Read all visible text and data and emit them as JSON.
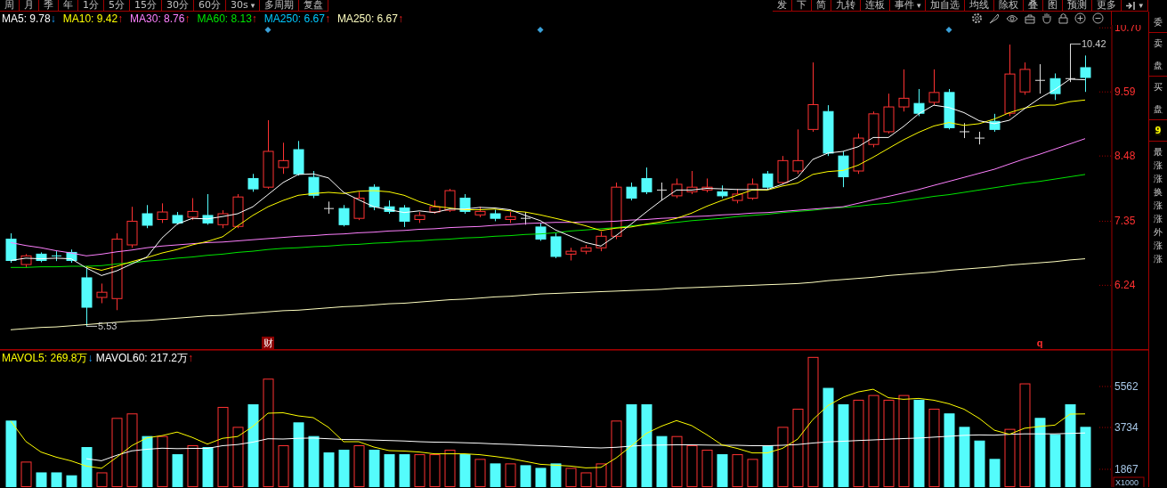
{
  "toolbar": {
    "left": [
      {
        "label": "周"
      },
      {
        "label": "月"
      },
      {
        "label": "季"
      },
      {
        "label": "年"
      },
      {
        "label": "1分"
      },
      {
        "label": "5分"
      },
      {
        "label": "15分"
      },
      {
        "label": "30分"
      },
      {
        "label": "60分"
      },
      {
        "label": "30s",
        "caret": "▾"
      },
      {
        "label": "多周期"
      },
      {
        "label": "复盘"
      }
    ],
    "right": [
      {
        "kind": "text",
        "label": "发"
      },
      {
        "kind": "text",
        "label": "下"
      },
      {
        "kind": "text",
        "label": "简"
      },
      {
        "kind": "text",
        "label": "九转"
      },
      {
        "kind": "text",
        "label": "连板"
      },
      {
        "kind": "text",
        "label": "事件",
        "caret": "▾"
      },
      {
        "kind": "text",
        "label": "加自选"
      },
      {
        "kind": "text",
        "label": "均线"
      },
      {
        "kind": "text",
        "label": "除权"
      },
      {
        "kind": "text",
        "label": "叠"
      },
      {
        "kind": "text",
        "label": "图"
      },
      {
        "kind": "text",
        "label": "预测"
      },
      {
        "kind": "text",
        "label": "更多"
      },
      {
        "kind": "icon",
        "caret": "▾"
      }
    ]
  },
  "ma_legend": [
    {
      "label": "MA5: 9.78",
      "arrow": "↓",
      "kind": "down",
      "color": "#ffffff"
    },
    {
      "label": "MA10: 9.42",
      "arrow": "↑",
      "kind": "up",
      "color": "#ffff00"
    },
    {
      "label": "MA30: 8.76",
      "arrow": "↑",
      "kind": "up",
      "color": "#ff80ff"
    },
    {
      "label": "MA60: 8.13",
      "arrow": "↑",
      "kind": "up",
      "color": "#00e600"
    },
    {
      "label": "MA250: 6.67",
      "arrow": "↑",
      "kind": "up",
      "color": "#00c8ff"
    },
    {
      "label": "MA250: 6.67",
      "arrow": "↑",
      "kind": "up",
      "color": "#ffffc0"
    }
  ],
  "price_panel": {
    "chart_data": {
      "type": "candlestick",
      "categories": [
        null,
        null,
        null,
        null,
        null,
        null,
        null,
        null,
        null,
        null,
        null,
        null,
        null,
        null,
        null,
        null,
        null,
        null,
        null,
        null,
        null,
        null,
        null,
        null,
        null,
        null,
        null,
        null,
        null,
        null,
        null,
        null,
        null,
        null,
        null,
        null,
        null,
        null,
        null,
        null,
        null,
        null,
        null,
        null,
        null,
        null,
        null,
        null,
        null,
        null,
        null,
        null,
        null,
        null,
        null,
        null,
        null,
        null,
        null,
        null,
        null,
        null,
        null,
        null,
        null,
        null,
        null,
        null,
        null,
        null,
        null,
        null
      ],
      "ylim": [
        5.12,
        10.75
      ],
      "yticks": [
        {
          "value": 10.7,
          "label": "10.70"
        },
        9.59,
        8.48,
        7.35,
        6.24
      ],
      "ohlc": [
        [
          7.04,
          7.14,
          6.63,
          6.67
        ],
        [
          6.6,
          6.78,
          6.55,
          6.75
        ],
        [
          6.78,
          6.81,
          6.64,
          6.67
        ],
        [
          6.75,
          6.83,
          6.66,
          6.74
        ],
        [
          6.81,
          6.86,
          6.63,
          6.67
        ],
        [
          6.37,
          6.55,
          5.53,
          5.86
        ],
        [
          6.03,
          6.27,
          5.93,
          6.12
        ],
        [
          6.01,
          7.14,
          5.81,
          7.04
        ],
        [
          6.94,
          7.6,
          6.89,
          7.35
        ],
        [
          7.48,
          7.63,
          7.23,
          7.28
        ],
        [
          7.38,
          7.66,
          7.32,
          7.51
        ],
        [
          7.45,
          7.51,
          7.29,
          7.32
        ],
        [
          7.42,
          7.75,
          7.37,
          7.52
        ],
        [
          7.45,
          7.82,
          7.29,
          7.32
        ],
        [
          7.29,
          7.54,
          7.23,
          7.48
        ],
        [
          7.26,
          7.82,
          7.23,
          7.77
        ],
        [
          8.09,
          8.17,
          7.86,
          7.91
        ],
        [
          7.94,
          9.1,
          7.91,
          8.56
        ],
        [
          8.28,
          8.71,
          8.17,
          8.4
        ],
        [
          8.59,
          8.74,
          8.14,
          8.17
        ],
        [
          8.11,
          8.22,
          7.75,
          7.8
        ],
        [
          7.57,
          7.69,
          7.48,
          7.57
        ],
        [
          7.57,
          7.63,
          7.26,
          7.29
        ],
        [
          7.4,
          7.86,
          7.37,
          7.75
        ],
        [
          7.94,
          7.99,
          7.54,
          7.6
        ],
        [
          7.6,
          7.71,
          7.48,
          7.52
        ],
        [
          7.58,
          7.63,
          7.25,
          7.35
        ],
        [
          7.38,
          7.51,
          7.32,
          7.45
        ],
        [
          7.51,
          7.71,
          7.48,
          7.6
        ],
        [
          7.54,
          7.91,
          7.51,
          7.88
        ],
        [
          7.75,
          7.82,
          7.48,
          7.52
        ],
        [
          7.46,
          7.6,
          7.42,
          7.52
        ],
        [
          7.48,
          7.55,
          7.35,
          7.4
        ],
        [
          7.38,
          7.51,
          7.32,
          7.43
        ],
        [
          7.4,
          7.51,
          7.29,
          7.4
        ],
        [
          7.25,
          7.32,
          7.01,
          7.04
        ],
        [
          7.08,
          7.14,
          6.71,
          6.74
        ],
        [
          6.78,
          6.89,
          6.67,
          6.83
        ],
        [
          6.83,
          6.94,
          6.78,
          6.89
        ],
        [
          6.89,
          7.17,
          6.83,
          7.09
        ],
        [
          7.09,
          8.02,
          7.04,
          7.94
        ],
        [
          7.94,
          8.02,
          7.71,
          7.75
        ],
        [
          8.09,
          8.28,
          7.82,
          7.86
        ],
        [
          7.89,
          8.02,
          7.71,
          7.89
        ],
        [
          7.79,
          8.09,
          7.75,
          7.99
        ],
        [
          7.86,
          8.22,
          7.82,
          7.94
        ],
        [
          7.89,
          8.09,
          7.85,
          7.94
        ],
        [
          7.86,
          7.97,
          7.75,
          7.79
        ],
        [
          7.71,
          7.91,
          7.66,
          7.82
        ],
        [
          7.75,
          8.09,
          7.72,
          7.99
        ],
        [
          8.17,
          8.22,
          7.91,
          7.94
        ],
        [
          8.02,
          8.48,
          7.99,
          8.4
        ],
        [
          8.22,
          8.94,
          8.17,
          8.4
        ],
        [
          8.94,
          10.1,
          8.9,
          9.37
        ],
        [
          9.25,
          9.36,
          8.48,
          8.53
        ],
        [
          8.48,
          8.56,
          7.94,
          8.12
        ],
        [
          8.22,
          8.87,
          8.17,
          8.79
        ],
        [
          8.68,
          9.25,
          8.63,
          9.21
        ],
        [
          8.9,
          9.56,
          8.87,
          9.33
        ],
        [
          9.33,
          9.98,
          9.25,
          9.48
        ],
        [
          9.39,
          9.64,
          9.17,
          9.22
        ],
        [
          9.41,
          9.98,
          9.36,
          9.58
        ],
        [
          9.58,
          9.64,
          8.94,
          8.97
        ],
        [
          8.9,
          9.05,
          8.79,
          8.9
        ],
        [
          8.79,
          8.9,
          8.68,
          8.79
        ],
        [
          9.08,
          9.21,
          8.9,
          8.94
        ],
        [
          9.22,
          10.41,
          9.17,
          9.9
        ],
        [
          9.59,
          10.1,
          9.54,
          9.98
        ],
        [
          9.79,
          10.07,
          9.56,
          9.79
        ],
        [
          9.82,
          9.91,
          9.45,
          9.56
        ],
        [
          9.82,
          10.42,
          9.76,
          9.82
        ],
        [
          10.01,
          10.22,
          9.59,
          9.84
        ]
      ],
      "series": [
        {
          "type": "line",
          "color": "#ffffc0",
          "values": [
            5.47,
            5.49,
            5.51,
            5.52,
            5.54,
            5.56,
            5.58,
            5.6,
            5.62,
            5.63,
            5.65,
            5.67,
            5.69,
            5.71,
            5.72,
            5.74,
            5.76,
            5.78,
            5.8,
            5.81,
            5.83,
            5.85,
            5.87,
            5.88,
            5.9,
            5.92,
            5.93,
            5.95,
            5.97,
            5.99,
            6.0,
            6.02,
            6.04,
            6.05,
            6.07,
            6.09,
            6.1,
            6.11,
            6.12,
            6.13,
            6.14,
            6.15,
            6.16,
            6.17,
            6.19,
            6.2,
            6.21,
            6.22,
            6.23,
            6.24,
            6.25,
            6.26,
            6.27,
            6.29,
            6.32,
            6.34,
            6.36,
            6.38,
            6.41,
            6.43,
            6.45,
            6.47,
            6.5,
            6.52,
            6.54,
            6.56,
            6.59,
            6.61,
            6.63,
            6.65,
            6.68,
            6.7
          ]
        },
        {
          "type": "line",
          "color": "#00e600",
          "values": [
            6.55,
            6.55,
            6.56,
            6.56,
            6.57,
            6.57,
            6.58,
            6.61,
            6.63,
            6.66,
            6.68,
            6.71,
            6.73,
            6.76,
            6.78,
            6.81,
            6.83,
            6.86,
            6.88,
            6.89,
            6.91,
            6.92,
            6.94,
            6.95,
            6.97,
            6.98,
            7.0,
            7.01,
            7.03,
            7.04,
            7.06,
            7.07,
            7.09,
            7.1,
            7.12,
            7.13,
            7.15,
            7.18,
            7.2,
            7.22,
            7.24,
            7.27,
            7.29,
            7.31,
            7.33,
            7.36,
            7.38,
            7.4,
            7.43,
            7.45,
            7.47,
            7.5,
            7.52,
            7.54,
            7.57,
            7.59,
            7.61,
            7.64,
            7.66,
            7.7,
            7.74,
            7.78,
            7.81,
            7.85,
            7.89,
            7.93,
            7.97,
            8.01,
            8.04,
            8.08,
            8.12,
            8.16
          ]
        },
        {
          "type": "line",
          "color": "#ff80ff",
          "values": [
            6.98,
            6.93,
            6.89,
            6.84,
            6.8,
            6.75,
            6.78,
            6.82,
            6.85,
            6.89,
            6.92,
            6.94,
            6.96,
            6.98,
            6.99,
            7.01,
            7.03,
            7.05,
            7.07,
            7.09,
            7.1,
            7.12,
            7.13,
            7.15,
            7.16,
            7.18,
            7.19,
            7.21,
            7.22,
            7.24,
            7.25,
            7.26,
            7.28,
            7.29,
            7.31,
            7.32,
            7.33,
            7.33,
            7.34,
            7.34,
            7.35,
            7.37,
            7.38,
            7.4,
            7.41,
            7.43,
            7.44,
            7.46,
            7.47,
            7.49,
            7.5,
            7.52,
            7.54,
            7.56,
            7.58,
            7.6,
            7.66,
            7.72,
            7.78,
            7.84,
            7.9,
            7.97,
            8.04,
            8.11,
            8.18,
            8.25,
            8.34,
            8.43,
            8.51,
            8.6,
            8.69,
            8.78
          ]
        },
        {
          "type": "line",
          "color": "#ffff00",
          "values": [
            null,
            null,
            null,
            null,
            null,
            6.56,
            6.5,
            6.57,
            6.65,
            6.72,
            6.8,
            6.86,
            6.94,
            7.0,
            7.08,
            7.27,
            7.45,
            7.6,
            7.71,
            7.8,
            7.83,
            7.85,
            7.83,
            7.87,
            7.88,
            7.86,
            7.8,
            7.69,
            7.61,
            7.58,
            7.55,
            7.55,
            7.56,
            7.53,
            7.51,
            7.46,
            7.4,
            7.34,
            7.27,
            7.19,
            7.23,
            7.25,
            7.3,
            7.34,
            7.4,
            7.49,
            7.61,
            7.71,
            7.8,
            7.89,
            7.89,
            7.96,
            8.01,
            8.16,
            8.21,
            8.23,
            8.32,
            8.46,
            8.61,
            8.76,
            8.89,
            9.0,
            9.06,
            9.01,
            9.04,
            9.12,
            9.23,
            9.31,
            9.36,
            9.36,
            9.42,
            9.45
          ]
        },
        {
          "type": "line",
          "color": "#ffffff",
          "values": [
            6.67,
            6.71,
            6.7,
            6.71,
            6.7,
            6.54,
            6.41,
            6.49,
            6.61,
            6.73,
            7.06,
            7.3,
            7.4,
            7.39,
            7.43,
            7.48,
            7.6,
            7.81,
            8.02,
            8.16,
            8.17,
            8.1,
            7.85,
            7.72,
            7.6,
            7.55,
            7.5,
            7.53,
            7.5,
            7.56,
            7.56,
            7.59,
            7.58,
            7.55,
            7.45,
            7.36,
            7.2,
            7.09,
            6.98,
            6.92,
            7.1,
            7.3,
            7.51,
            7.71,
            7.89,
            7.89,
            7.92,
            7.91,
            7.9,
            7.9,
            7.9,
            7.99,
            8.11,
            8.42,
            8.53,
            8.56,
            8.64,
            8.8,
            8.8,
            8.99,
            9.21,
            9.36,
            9.32,
            9.23,
            9.09,
            9.04,
            9.1,
            9.3,
            9.48,
            9.63,
            9.81,
            9.8
          ]
        }
      ],
      "annotations": [
        "财",
        "q",
        "5.53",
        "10.42"
      ]
    }
  },
  "volume_panel": {
    "legend": [
      {
        "label": "MAVOL5: 269.8万",
        "arrow": "↓",
        "kind": "down",
        "color": "#ffff00"
      },
      {
        "label": "MAVOL60: 217.2万",
        "arrow": "↑",
        "kind": "up",
        "color": "#ffffff"
      }
    ],
    "unit_label": "X1000",
    "chart_data": {
      "type": "bar",
      "categories": [
        null,
        null,
        null,
        null,
        null,
        null,
        null,
        null,
        null,
        null,
        null,
        null,
        null,
        null,
        null,
        null,
        null,
        null,
        null,
        null,
        null,
        null,
        null,
        null,
        null,
        null,
        null,
        null,
        null,
        null,
        null,
        null,
        null,
        null,
        null,
        null,
        null,
        null,
        null,
        null,
        null,
        null,
        null,
        null,
        null,
        null,
        null,
        null,
        null,
        null,
        null,
        null,
        null,
        null,
        null,
        null,
        null,
        null,
        null,
        null,
        null,
        null,
        null,
        null,
        null,
        null,
        null,
        null,
        null,
        null,
        null,
        null
      ],
      "ylim": [
        1073,
        7191
      ],
      "yticks": [
        5562,
        3734,
        1867
      ],
      "series": [
        {
          "colors": [
            "#54fcfc",
            "#ff3232",
            "#54fcfc",
            "#54fcfc",
            "#54fcfc",
            "#54fcfc",
            "#ff3232",
            "#ff3232",
            "#ff3232",
            "#54fcfc",
            "#ff3232",
            "#54fcfc",
            "#ff3232",
            "#54fcfc",
            "#ff3232",
            "#ff3232",
            "#54fcfc",
            "#ff3232",
            "#ff3232",
            "#54fcfc",
            "#54fcfc",
            "#54fcfc",
            "#54fcfc",
            "#ff3232",
            "#54fcfc",
            "#54fcfc",
            "#54fcfc",
            "#ff3232",
            "#ff3232",
            "#ff3232",
            "#54fcfc",
            "#ff3232",
            "#54fcfc",
            "#ff3232",
            "#54fcfc",
            "#54fcfc",
            "#54fcfc",
            "#ff3232",
            "#ff3232",
            "#ff3232",
            "#ff3232",
            "#54fcfc",
            "#54fcfc",
            "#54fcfc",
            "#ff3232",
            "#ff3232",
            "#ff3232",
            "#54fcfc",
            "#ff3232",
            "#ff3232",
            "#54fcfc",
            "#ff3232",
            "#ff3232",
            "#ff3232",
            "#54fcfc",
            "#54fcfc",
            "#ff3232",
            "#ff3232",
            "#ff3232",
            "#ff3232",
            "#54fcfc",
            "#ff3232",
            "#54fcfc",
            "#54fcfc",
            "#54fcfc",
            "#54fcfc",
            "#ff3232",
            "#ff3232",
            "#54fcfc",
            "#54fcfc",
            "#54fcfc",
            "#54fcfc"
          ],
          "values": [
            4020,
            2190,
            1710,
            1710,
            1580,
            2840,
            1710,
            4140,
            4340,
            3330,
            3330,
            2520,
            2920,
            2840,
            4630,
            3740,
            4750,
            5890,
            2920,
            3940,
            3330,
            2600,
            2720,
            2920,
            2720,
            2520,
            2520,
            2520,
            2520,
            2720,
            2520,
            2310,
            2110,
            2110,
            2030,
            1910,
            2110,
            1910,
            1710,
            2110,
            4020,
            4750,
            4750,
            3330,
            3330,
            2920,
            2720,
            2520,
            2520,
            2310,
            2920,
            3740,
            4550,
            6860,
            5480,
            4750,
            4950,
            5160,
            4950,
            5160,
            4950,
            4550,
            4340,
            3740,
            3130,
            2310,
            3650,
            5680,
            4140,
            3410,
            4750,
            3740
          ]
        },
        {
          "type": "line",
          "color": "#ffffff",
          "values": [
            null,
            null,
            null,
            null,
            null,
            2340,
            2250,
            2490,
            2690,
            2760,
            2810,
            2790,
            2800,
            2800,
            2920,
            2970,
            3080,
            3230,
            3220,
            3250,
            3260,
            3230,
            3200,
            3190,
            3170,
            3150,
            3130,
            3100,
            3080,
            3070,
            3050,
            3030,
            3000,
            2980,
            2950,
            2920,
            2900,
            2870,
            2840,
            2820,
            2850,
            2900,
            2940,
            2950,
            2960,
            2960,
            2950,
            2940,
            2940,
            2920,
            2920,
            2940,
            2970,
            3040,
            3090,
            3120,
            3150,
            3180,
            3210,
            3240,
            3260,
            3300,
            3340,
            3380,
            3400,
            3390,
            3430,
            3450,
            3450,
            3450,
            3470,
            3490
          ]
        },
        {
          "type": "line",
          "color": "#ffff00",
          "values": [
            4020,
            3110,
            2640,
            2410,
            2240,
            2010,
            1910,
            2400,
            2920,
            3270,
            3370,
            3530,
            3290,
            2990,
            3250,
            3330,
            3780,
            4370,
            4390,
            4250,
            4170,
            3740,
            3100,
            3100,
            2860,
            2700,
            2680,
            2640,
            2560,
            2560,
            2560,
            2520,
            2440,
            2350,
            2220,
            2090,
            2050,
            2010,
            1930,
            1950,
            2370,
            2900,
            3470,
            3790,
            4040,
            3820,
            3410,
            2960,
            2800,
            2600,
            2600,
            2800,
            3210,
            4080,
            4710,
            5080,
            5320,
            5440,
            5060,
            4990,
            5030,
            4950,
            4790,
            4550,
            4140,
            3610,
            3430,
            3700,
            3780,
            3840,
            4330,
            4340
          ]
        }
      ]
    }
  },
  "side_panel": [
    {
      "chars": [
        "委"
      ],
      "highlight": false
    },
    {
      "chars": [
        "卖",
        "盘"
      ],
      "highlight": false
    },
    {
      "chars": [
        "买",
        "盘"
      ],
      "highlight": false
    },
    {
      "chars": [
        "9"
      ],
      "highlight": true
    },
    {
      "chars": [
        "最",
        "涨",
        "涨",
        "换",
        "涨",
        "涨",
        "外",
        "涨",
        "涨"
      ],
      "highlight": false
    }
  ]
}
